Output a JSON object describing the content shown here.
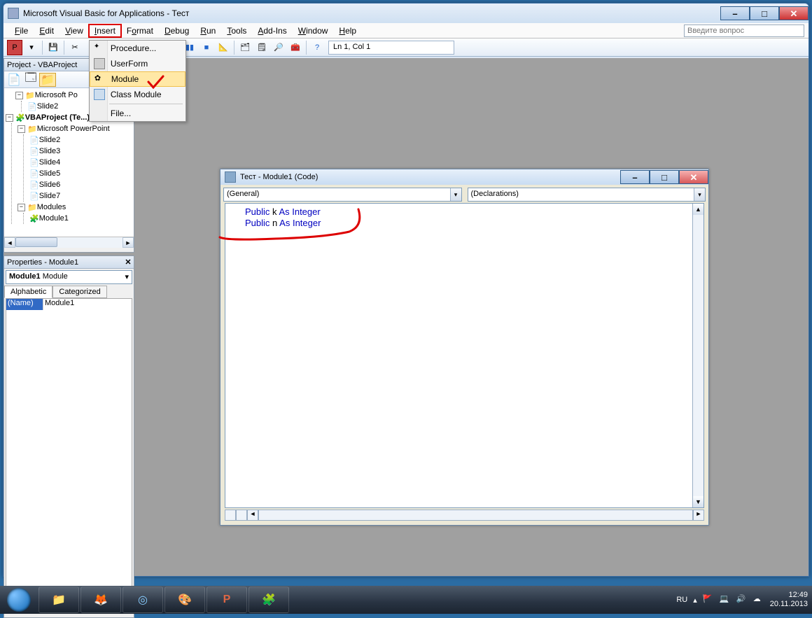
{
  "window": {
    "title": "Microsoft Visual Basic for Applications - Тест"
  },
  "menubar": {
    "items": [
      "File",
      "Edit",
      "View",
      "Insert",
      "Format",
      "Debug",
      "Run",
      "Tools",
      "Add-Ins",
      "Window",
      "Help"
    ],
    "question_placeholder": "Введите вопрос"
  },
  "insert_menu": {
    "items": [
      "Procedure...",
      "UserForm",
      "Module",
      "Class Module",
      "File..."
    ],
    "highlighted_index": 2
  },
  "toolbar": {
    "status": "Ln 1, Col 1"
  },
  "project_pane": {
    "title": "Project - VBAProject",
    "tree": {
      "proj1_label": "Microsoft Po",
      "proj1_slides": [
        "Slide2"
      ],
      "proj2_label": "VBAProject (Те...)",
      "proj2_folder": "Microsoft PowerPoint",
      "proj2_slides": [
        "Slide2",
        "Slide3",
        "Slide4",
        "Slide5",
        "Slide6",
        "Slide7"
      ],
      "modules_label": "Modules",
      "modules": [
        "Module1"
      ]
    }
  },
  "properties_pane": {
    "title": "Properties - Module1",
    "object": "Module1",
    "object_type": "Module",
    "tabs": [
      "Alphabetic",
      "Categorized"
    ],
    "rows": [
      {
        "name": "(Name)",
        "value": "Module1"
      }
    ]
  },
  "code_window": {
    "title": "Тест - Module1 (Code)",
    "combo_left": "(General)",
    "combo_right": "(Declarations)",
    "lines": [
      {
        "kw1": "Public",
        "var": " k ",
        "kw2": "As",
        "type": " Integer"
      },
      {
        "kw1": "Public",
        "var": " n ",
        "kw2": "As",
        "type": " Integer"
      }
    ]
  },
  "taskbar": {
    "lang": "RU",
    "time": "12:49",
    "date": "20.11.2013"
  }
}
